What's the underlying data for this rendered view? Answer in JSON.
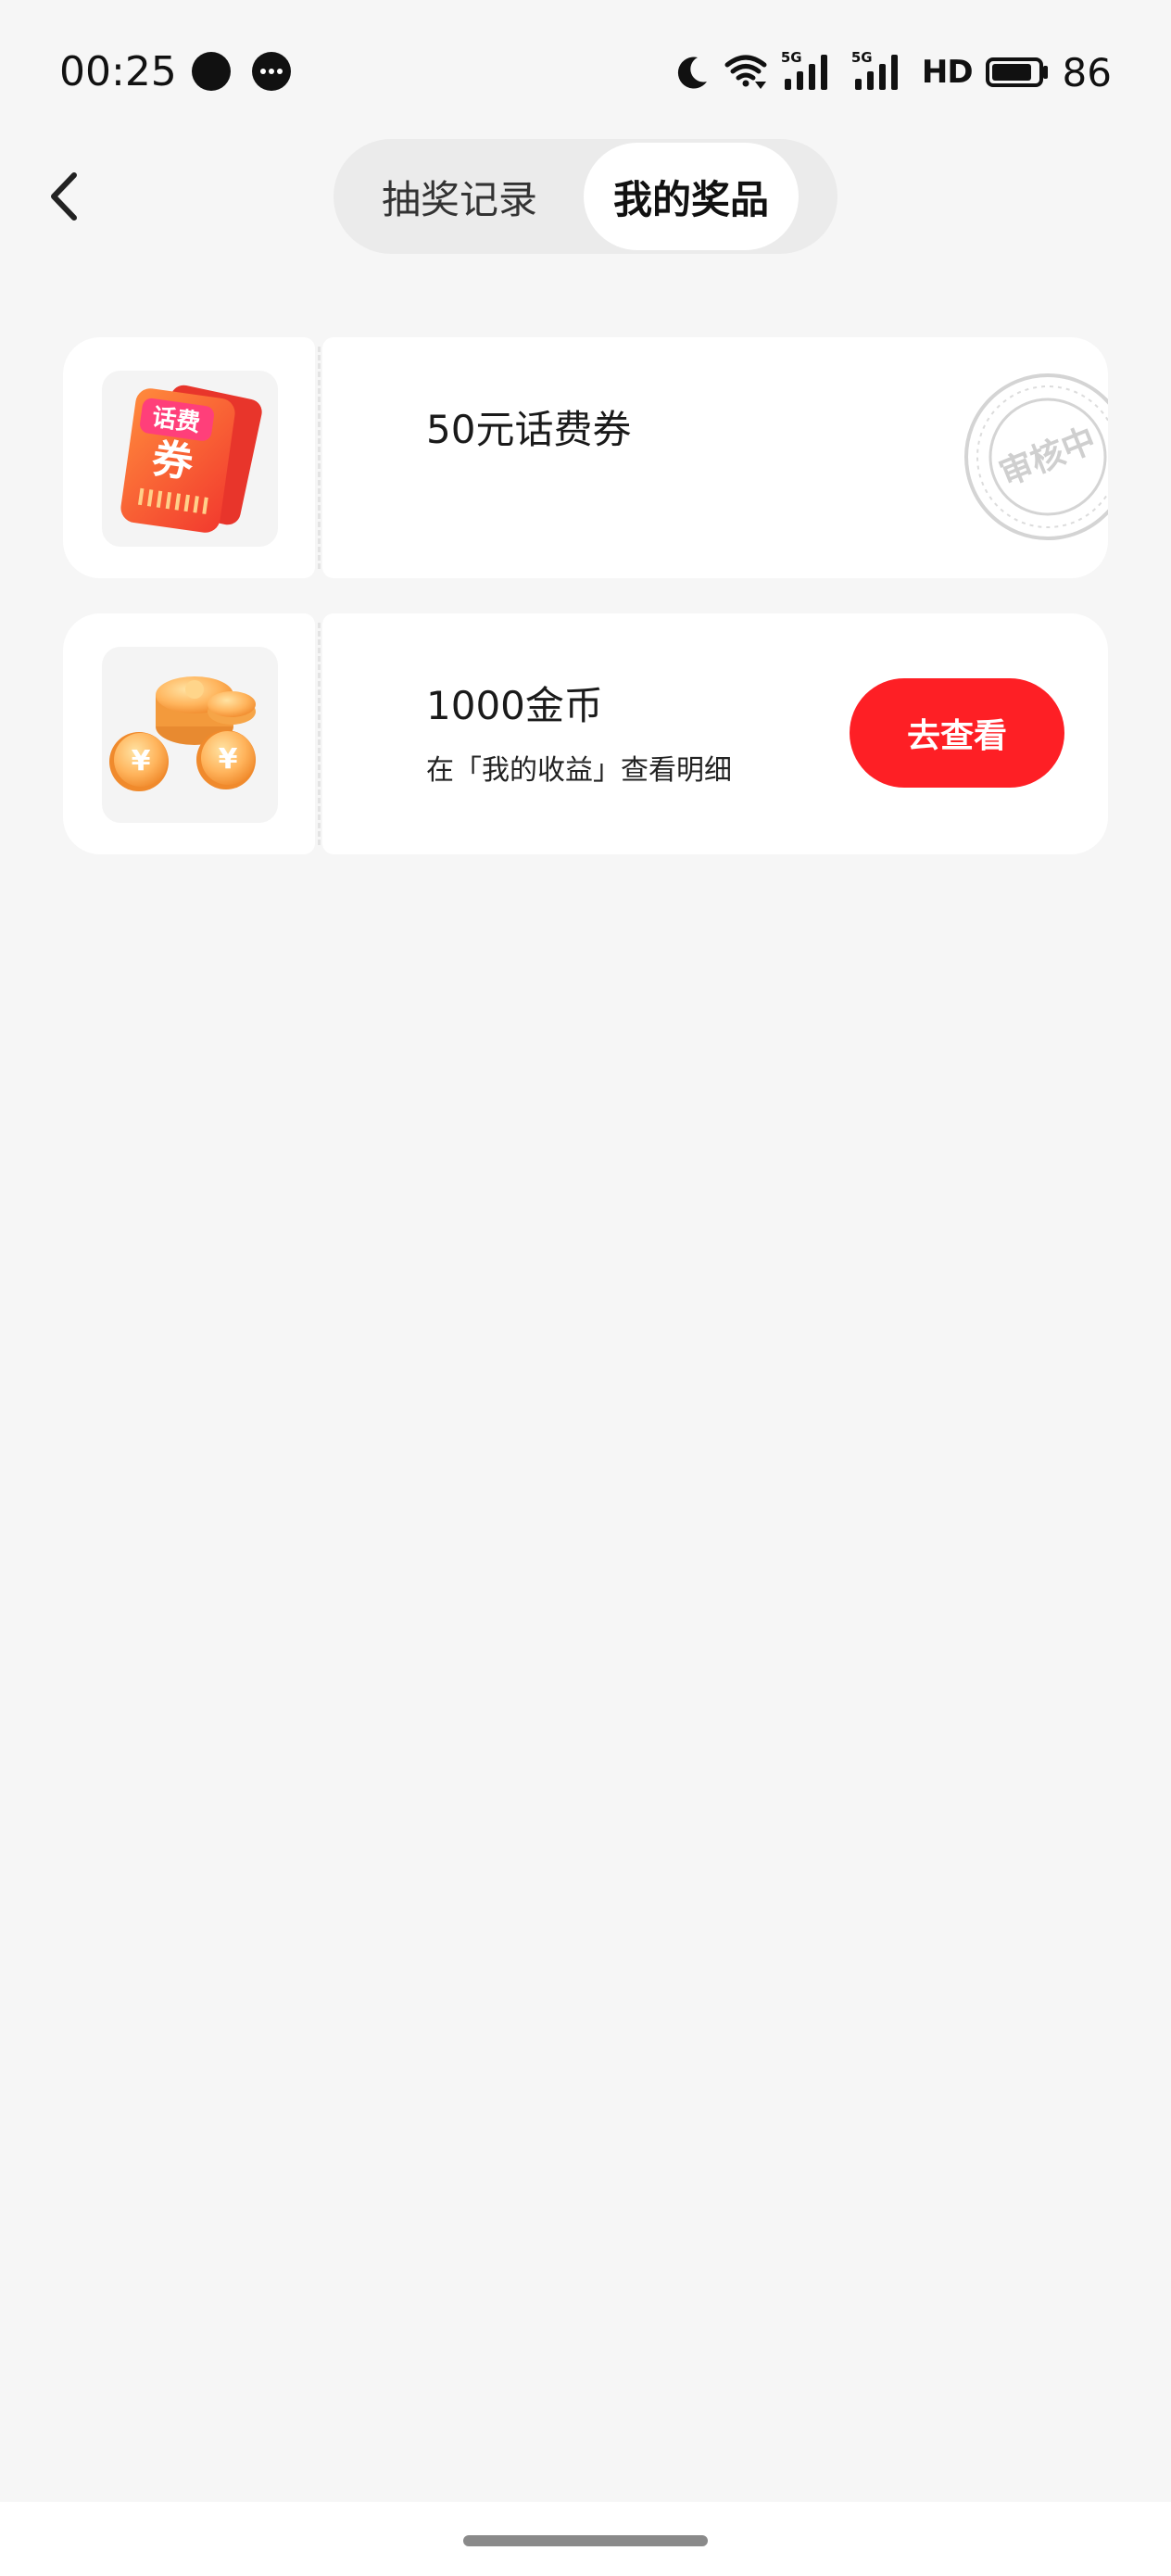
{
  "status_bar": {
    "time": "00:25",
    "network_label_1": "5G",
    "network_label_2": "5G",
    "hd_label": "HD",
    "battery_level": "86",
    "icons": [
      "chat-bubble-icon",
      "message-dots-icon",
      "moon-icon",
      "wifi-icon",
      "signal-5g-icon",
      "signal-5g-icon",
      "hd-icon",
      "battery-icon"
    ]
  },
  "header": {
    "tabs": [
      {
        "label": "抽奖记录",
        "active": false
      },
      {
        "label": "我的奖品",
        "active": true
      }
    ]
  },
  "prizes": [
    {
      "title": "50元话费券",
      "image_badge": "话费",
      "image_big": "券",
      "stamp_text": "审核中",
      "icon": "phone-voucher-icon"
    },
    {
      "title": "1000金币",
      "description": "在「我的收益」查看明细",
      "action_label": "去查看",
      "icon": "gold-coins-icon"
    }
  ],
  "colors": {
    "background": "#f6f6f6",
    "card": "#ffffff",
    "accent_red": "#fe1f25",
    "segment_bg": "#ebebeb",
    "stamp_gray": "#cfcfcf"
  }
}
